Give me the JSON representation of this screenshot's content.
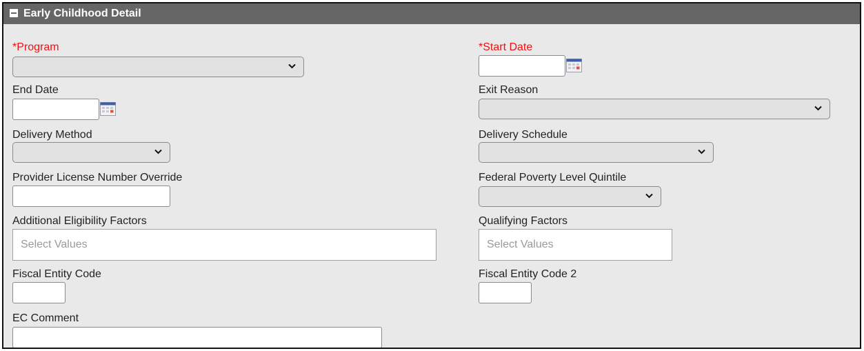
{
  "section": {
    "title": "Early Childhood Detail"
  },
  "fields": {
    "program": {
      "label": "*Program",
      "value": ""
    },
    "start_date": {
      "label": "*Start Date",
      "value": ""
    },
    "end_date": {
      "label": "End Date",
      "value": ""
    },
    "exit_reason": {
      "label": "Exit Reason",
      "value": ""
    },
    "delivery_method": {
      "label": "Delivery Method",
      "value": ""
    },
    "delivery_schedule": {
      "label": "Delivery Schedule",
      "value": ""
    },
    "provider_license": {
      "label": "Provider License Number Override",
      "value": ""
    },
    "fpl_quintile": {
      "label": "Federal Poverty Level Quintile",
      "value": ""
    },
    "additional_eligibility": {
      "label": "Additional Eligibility Factors",
      "placeholder": "Select Values"
    },
    "qualifying_factors": {
      "label": "Qualifying Factors",
      "placeholder": "Select Values"
    },
    "fiscal_entity_code": {
      "label": "Fiscal Entity Code",
      "value": ""
    },
    "fiscal_entity_code_2": {
      "label": "Fiscal Entity Code 2",
      "value": ""
    },
    "ec_comment": {
      "label": "EC Comment",
      "value": ""
    }
  },
  "icons": {
    "section_toggle": "collapse-icon",
    "calendar": "calendar-icon",
    "dropdown": "chevron-down-icon"
  },
  "colors": {
    "header_bg": "#666666",
    "panel_bg": "#e9e9e9",
    "required_label": "#ee1111"
  }
}
